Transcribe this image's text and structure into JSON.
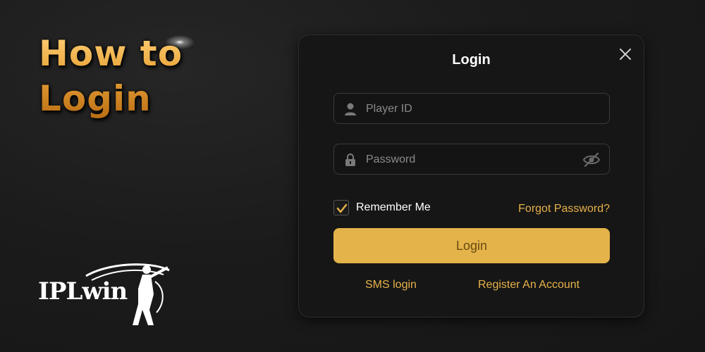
{
  "banner": {
    "headline_line1": "How to",
    "headline_line2": "Login"
  },
  "brand": {
    "logo_text": "IPLwin"
  },
  "modal": {
    "title": "Login",
    "player_id": {
      "value": "",
      "placeholder": "Player ID",
      "icon": "user-icon"
    },
    "password": {
      "value": "",
      "placeholder": "Password",
      "icon": "lock-icon",
      "toggle_icon": "eye-slash-icon"
    },
    "remember_me": {
      "label": "Remember Me",
      "checked": true
    },
    "forgot_password": "Forgot Password?",
    "login_button": "Login",
    "sms_login": "SMS login",
    "register": "Register An Account"
  },
  "colors": {
    "accent": "#e4b34a",
    "link": "#e8b24a",
    "background": "#1b1b1b",
    "modal": "#161616"
  }
}
